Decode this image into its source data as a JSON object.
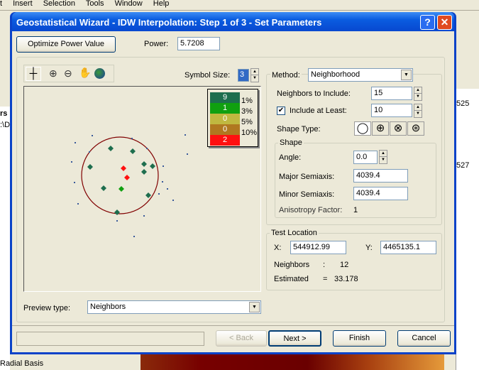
{
  "menu": [
    "t",
    "Insert",
    "Selection",
    "Tools",
    "Window",
    "Help"
  ],
  "background": {
    "left_labels": [
      "rs",
      ":\\D",
      "Radial Basis"
    ],
    "right_labels": [
      "525",
      "527"
    ]
  },
  "dialog": {
    "title": "Geostatistical Wizard - IDW Interpolation: Step 1 of 3 - Set Parameters",
    "help_btn": "?",
    "close_btn": "✕",
    "optimize_label": "Optimize Power Value",
    "power_label": "Power:",
    "power_value": "5.7208",
    "symbol_size_label": "Symbol Size:",
    "symbol_size_value": "3",
    "tools": [
      "select-tool",
      "zoom-in-icon",
      "zoom-out-icon",
      "pan-hand-icon",
      "full-extent-globe-icon"
    ],
    "legend": [
      {
        "count": "9",
        "color": "#1e6e4e",
        "pct": "1%"
      },
      {
        "count": "1",
        "color": "#10a010",
        "pct": "3%"
      },
      {
        "count": "0",
        "color": "#c0b840",
        "pct": "5%"
      },
      {
        "count": "0",
        "color": "#b07820",
        "pct": "10%"
      },
      {
        "count": "2",
        "color": "#ff1010",
        "pct": ""
      }
    ],
    "preview_type_label": "Preview type:",
    "preview_type_value": "Neighbors",
    "method_label": "Method:",
    "method_value": "Neighborhood",
    "neighbors_label": "Neighbors to Include:",
    "neighbors_value": "15",
    "include_least_label": "Include at Least:",
    "include_least_value": "10",
    "include_least_checked": true,
    "shape_type_label": "Shape Type:",
    "shape": {
      "group": "Shape",
      "angle_label": "Angle:",
      "angle": "0.0",
      "major_label": "Major Semiaxis:",
      "major": "4039.4",
      "minor_label": "Minor Semiaxis:",
      "minor": "4039.4",
      "aniso_label": "Anisotropy Factor:",
      "aniso": "1"
    },
    "test": {
      "group": "Test Location",
      "x_label": "X:",
      "x": "544912.99",
      "y_label": "Y:",
      "y": "4465135.1",
      "neighbors_label": "Neighbors",
      "neighbors_sep": ":",
      "neighbors": "12",
      "estimated_label": "Estimated",
      "estimated_sep": "=",
      "estimated": "33.178"
    },
    "buttons": {
      "back": "< Back",
      "next": "Next >",
      "finish": "Finish",
      "cancel": "Cancel"
    }
  }
}
